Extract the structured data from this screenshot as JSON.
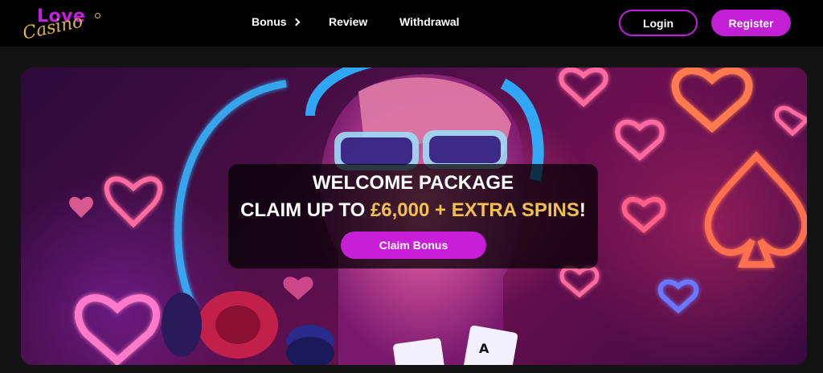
{
  "brand": {
    "logo_love": "Love",
    "logo_casino": "Casino",
    "colors": {
      "purple": "#c21fd6",
      "gold": "#f2c14e",
      "black": "#000000"
    }
  },
  "nav": {
    "items": [
      {
        "label": "Bonus",
        "has_dropdown": true,
        "icon": "chevron-right-icon"
      },
      {
        "label": "Review"
      },
      {
        "label": "Withdrawal"
      }
    ]
  },
  "auth": {
    "login_label": "Login",
    "register_label": "Register"
  },
  "hero": {
    "promo_title": "WELCOME PACKAGE",
    "promo_prefix": "CLAIM UP TO ",
    "promo_highlight": "£6,000 + EXTRA SPINS",
    "promo_suffix": "!",
    "claim_label": "Claim Bonus",
    "image_description": "Neon casino artwork: woman with headphones and sunglasses, glowing hearts and spades, poker chips and playing cards"
  }
}
